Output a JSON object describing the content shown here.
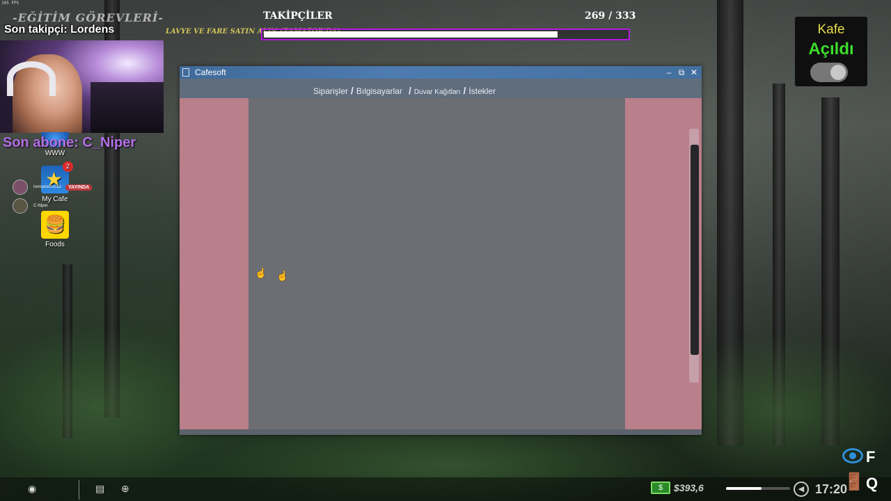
{
  "overlay": {
    "fps": "105 FPS",
    "tasks_title": "-EĞİTİM GÖREVLERİ-",
    "tasks_line": "LAVYE VE FARE SATIN ALIN (ZAMAZOR'DA)",
    "last_follower": "Son takipçi: Lordens",
    "last_subscriber": "Son abone: C_Niper",
    "followers": {
      "label": "TAKİPÇİLER",
      "count": "269 / 333",
      "current": 269,
      "goal": 333
    },
    "kafe": {
      "label": "Kafe",
      "status": "Açıldı",
      "toggle_on": true
    },
    "viewers": [
      {
        "name": "iremamorursuz",
        "badge": "YAYINDA"
      },
      {
        "name": "C-Niper",
        "badge": ""
      }
    ]
  },
  "desktop": {
    "icons": [
      {
        "label": "WWW",
        "icon": "globe-icon",
        "badge": ""
      },
      {
        "label": "My Cafe",
        "icon": "star-icon",
        "badge": "2"
      },
      {
        "label": "Foods",
        "icon": "food-icon",
        "badge": ""
      }
    ]
  },
  "window": {
    "title": "Cafesoft",
    "controls": {
      "minimize": "–",
      "maximize": "⧉",
      "close": "✕"
    },
    "nav": {
      "orders": "Siparişler",
      "computers": "Bılgisayarlar",
      "wallpapers": "Duvar Kağıtları",
      "requests": "İstekler",
      "separator": "/"
    },
    "colors": {
      "side_panel": "#b97f8a",
      "main_pane": "#6d6d74",
      "titlebar": "#4e7bb0"
    }
  },
  "taskbar": {
    "money": "$393,6",
    "money_icon": "$",
    "clock": "17:20",
    "volume_level": 0.55,
    "keys": {
      "interact": "F",
      "exit": "Q"
    }
  }
}
